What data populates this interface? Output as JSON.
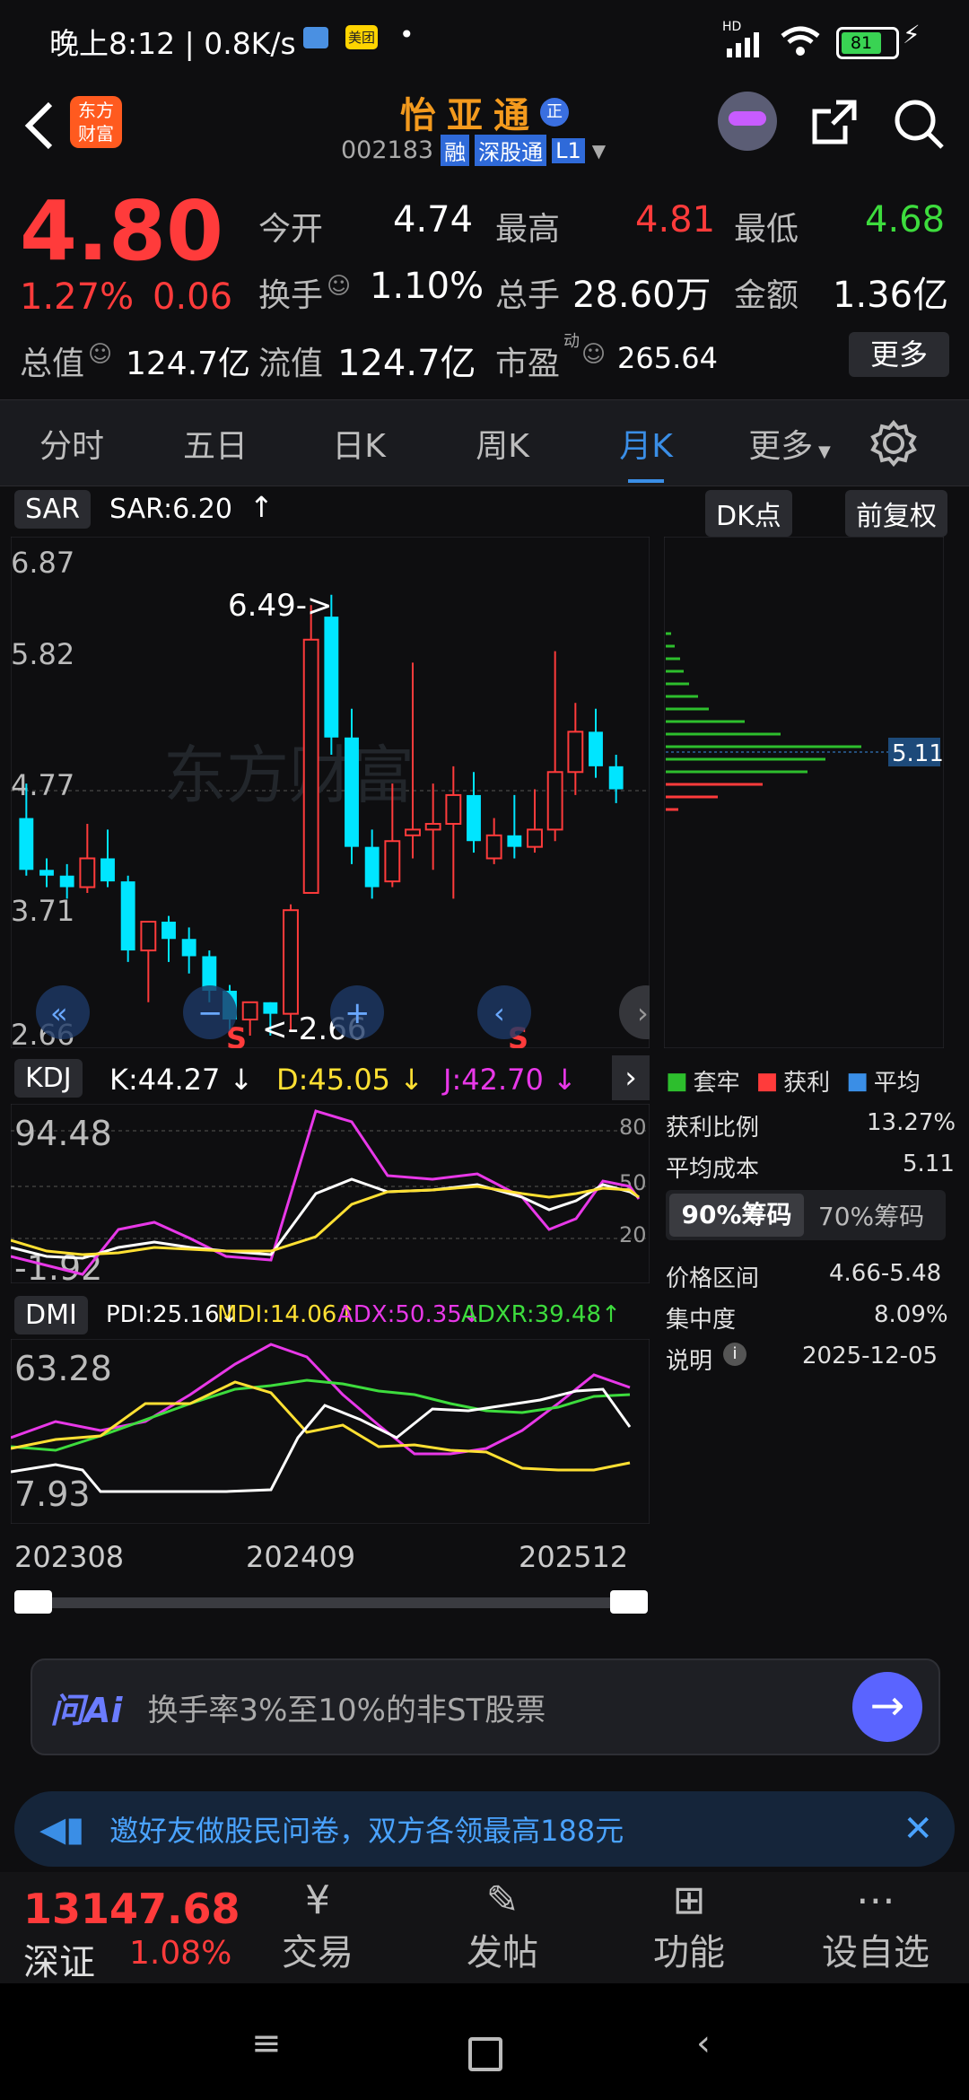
{
  "status": {
    "time_speed": "晚上8:12 | 0.8K/s",
    "app_badge_1": "美团",
    "dot": "•",
    "network": "HD",
    "battery": "81"
  },
  "header": {
    "logo_line1": "东方",
    "logo_line2": "财富",
    "stock_name": "怡亚通",
    "stock_badge": "正",
    "code": "002183",
    "tag_rong": "融",
    "tag_sgt": "深股通",
    "tag_l1": "L1"
  },
  "quote": {
    "price": "4.80",
    "change_pct": "1.27%",
    "change_abs": "0.06",
    "open_label": "今开",
    "open": "4.74",
    "high_label": "最高",
    "high": "4.81",
    "low_label": "最低",
    "low": "4.68",
    "turnover_label": "换手",
    "turnover": "1.10%",
    "volume_label": "总手",
    "volume": "28.60万",
    "amount_label": "金额",
    "amount": "1.36亿",
    "mktcap_label": "总值",
    "mktcap": "124.7亿",
    "float_label": "流值",
    "float": "124.7亿",
    "pe_label": "市盈",
    "pe_sup": "动",
    "pe": "265.64",
    "more": "更多"
  },
  "tabs": [
    "分时",
    "五日",
    "日K",
    "周K",
    "月K",
    "更多"
  ],
  "chart": {
    "indicator": "SAR",
    "sar_value": "SAR:6.20",
    "sar_arrow": "↑",
    "dk_label": "DK点",
    "fq_label": "前复权",
    "y_ticks": [
      "6.87",
      "5.82",
      "4.77",
      "3.71",
      "2.66"
    ],
    "high_annot": "6.49->",
    "low_annot": "<-2.66",
    "s_marks": [
      "S",
      "S"
    ],
    "chip_price": "5.11",
    "watermark": "东方财富"
  },
  "chart_data": [
    {
      "type": "candlestick",
      "title": "",
      "y_range": [
        2.66,
        6.87
      ],
      "x_tick_labels": [
        "202308",
        "202409",
        "202512"
      ],
      "candles": [
        {
          "o": 4.55,
          "h": 4.85,
          "c": 4.1,
          "l": 4.05
        },
        {
          "o": 4.1,
          "h": 4.2,
          "c": 4.05,
          "l": 3.95
        },
        {
          "o": 4.05,
          "h": 4.15,
          "c": 3.95,
          "l": 3.85
        },
        {
          "o": 3.95,
          "h": 4.5,
          "c": 4.2,
          "l": 3.9
        },
        {
          "o": 4.2,
          "h": 4.45,
          "c": 4.0,
          "l": 3.95
        },
        {
          "o": 4.0,
          "h": 4.05,
          "c": 3.4,
          "l": 3.3
        },
        {
          "o": 3.4,
          "h": 3.55,
          "c": 3.65,
          "l": 2.95
        },
        {
          "o": 3.65,
          "h": 3.7,
          "c": 3.5,
          "l": 3.3
        },
        {
          "o": 3.5,
          "h": 3.6,
          "c": 3.35,
          "l": 3.2
        },
        {
          "o": 3.35,
          "h": 3.4,
          "c": 3.05,
          "l": 2.95
        },
        {
          "o": 3.05,
          "h": 3.1,
          "c": 2.8,
          "l": 2.7
        },
        {
          "o": 2.8,
          "h": 2.95,
          "c": 2.95,
          "l": 2.66
        },
        {
          "o": 2.95,
          "h": 2.95,
          "c": 2.85,
          "l": 2.66
        },
        {
          "o": 2.85,
          "h": 3.8,
          "c": 3.75,
          "l": 2.7
        },
        {
          "o": 3.9,
          "h": 6.4,
          "c": 6.1,
          "l": 3.9
        },
        {
          "o": 6.3,
          "h": 6.49,
          "c": 5.25,
          "l": 5.1
        },
        {
          "o": 5.25,
          "h": 5.5,
          "c": 4.3,
          "l": 4.15
        },
        {
          "o": 4.3,
          "h": 4.45,
          "c": 3.95,
          "l": 3.85
        },
        {
          "o": 4.0,
          "h": 4.85,
          "c": 4.35,
          "l": 3.95
        },
        {
          "o": 4.4,
          "h": 5.9,
          "c": 4.45,
          "l": 4.2
        },
        {
          "o": 4.45,
          "h": 4.85,
          "c": 4.5,
          "l": 4.1
        },
        {
          "o": 4.5,
          "h": 5.0,
          "c": 4.75,
          "l": 3.85
        },
        {
          "o": 4.75,
          "h": 4.95,
          "c": 4.35,
          "l": 4.25
        },
        {
          "o": 4.2,
          "h": 4.55,
          "c": 4.4,
          "l": 4.15
        },
        {
          "o": 4.4,
          "h": 4.75,
          "c": 4.3,
          "l": 4.2
        },
        {
          "o": 4.3,
          "h": 4.8,
          "c": 4.45,
          "l": 4.25
        },
        {
          "o": 4.45,
          "h": 6.0,
          "c": 4.95,
          "l": 4.35
        },
        {
          "o": 4.95,
          "h": 5.55,
          "c": 5.3,
          "l": 4.75
        },
        {
          "o": 5.3,
          "h": 5.5,
          "c": 5.0,
          "l": 4.9
        },
        {
          "o": 5.0,
          "h": 5.1,
          "c": 4.8,
          "l": 4.68
        }
      ]
    }
  ],
  "kdj": {
    "name": "KDJ",
    "k": "K:44.27",
    "k_arrow": "↓",
    "d": "D:45.05",
    "d_arrow": "↓",
    "j": "J:42.70",
    "j_arrow": "↓",
    "max": "94.48",
    "min": "-1.92",
    "r80": "80",
    "r50": "50",
    "r20": "20"
  },
  "dmi": {
    "name": "DMI",
    "pdi": "PDI:25.16",
    "pdi_arrow": "↓",
    "mdi": "MDI:14.06",
    "mdi_arrow": "↑",
    "adx": "ADX:50.35",
    "adx_arrow": "↓",
    "adxr": "ADXR:39.48",
    "adxr_arrow": "↑",
    "max": "63.28",
    "min": "7.93"
  },
  "x_axis": [
    "202308",
    "202409",
    "202512"
  ],
  "chip": {
    "legend": [
      "套牢",
      "获利",
      "平均"
    ],
    "rows": [
      {
        "label": "获利比例",
        "value": "13.27%"
      },
      {
        "label": "平均成本",
        "value": "5.11"
      }
    ],
    "tab_90": "90%筹码",
    "tab_70": "70%筹码",
    "rows2": [
      {
        "label": "价格区间",
        "value": "4.66-5.48"
      },
      {
        "label": "集中度",
        "value": "8.09%"
      },
      {
        "label": "说明",
        "value": "2025-12-05"
      }
    ]
  },
  "ai_bar": {
    "logo": "问Ai",
    "placeholder": "换手率3%至10%的非ST股票"
  },
  "banner": {
    "text": "邀好友做股民问卷，双方各领最高188元"
  },
  "bottom_nav": {
    "index_value": "13147.68",
    "index_name": "深证",
    "index_pct": "1.08%",
    "items": [
      "交易",
      "发帖",
      "功能",
      "设自选"
    ]
  },
  "colors": {
    "up": "#ff3b3b",
    "down": "#00e5ff",
    "accent": "#3a8ee6",
    "kdj_k": "#ffffff",
    "kdj_d": "#ffe033",
    "kdj_j": "#e838e8"
  }
}
